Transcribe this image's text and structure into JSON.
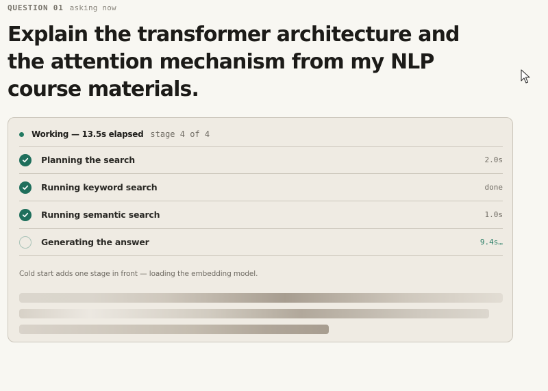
{
  "question": {
    "number_label": "QUESTION 01",
    "status": "asking now",
    "title": "Explain the transformer architecture and the attention mechanism from my NLP course materials."
  },
  "progress": {
    "working_label": "Working — 13.5s elapsed",
    "stage_label": "stage 4 of 4",
    "stages": [
      {
        "label": "Planning the search",
        "time": "2.0s",
        "state": "done"
      },
      {
        "label": "Running keyword search",
        "time": "done",
        "state": "done"
      },
      {
        "label": "Running semantic search",
        "time": "1.0s",
        "state": "done"
      },
      {
        "label": "Generating the answer",
        "time": "9.4s…",
        "state": "active"
      }
    ],
    "footnote": "Cold start adds one stage in front — loading the embedding model."
  },
  "colors": {
    "accent": "#1f6f5c",
    "background": "#f8f7f2",
    "card": "#efebe3"
  },
  "icons": {
    "done": "check-circle-icon",
    "pending": "empty-circle-icon",
    "cursor": "mouse-pointer-icon"
  }
}
